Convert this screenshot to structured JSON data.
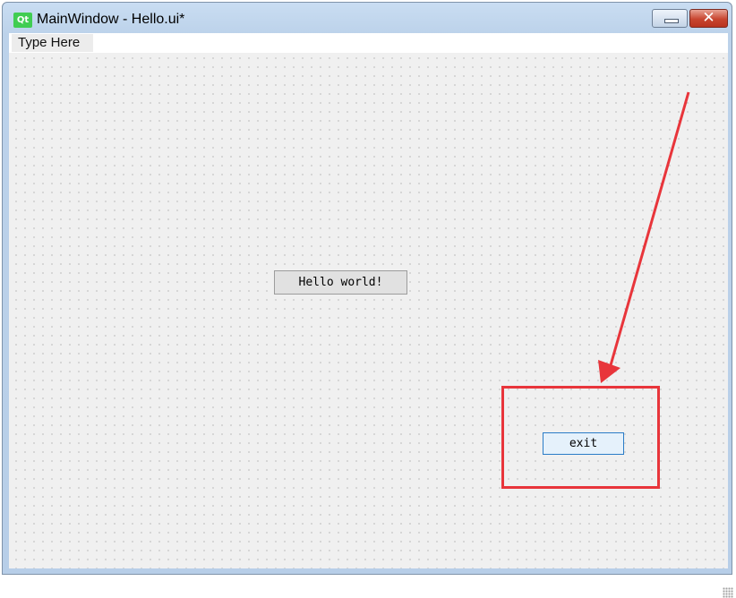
{
  "window": {
    "title": "MainWindow - Hello.ui*",
    "logo_text": "Qt",
    "controls": {
      "minimize_icon": "minimize-icon",
      "close_icon": "close-icon",
      "close_glyph": "✕"
    }
  },
  "menubar": {
    "placeholder_item": "Type Here"
  },
  "form": {
    "hello_button_label": "Hello world!",
    "exit_button_label": "exit"
  },
  "annotation": {
    "color": "#e8353b",
    "arrow_icon": "red-arrow-annotation",
    "target": "exit"
  },
  "colors": {
    "qt_brand": "#41cd52",
    "selection_border": "#2a7cc7",
    "close_button": "#c8452f"
  }
}
